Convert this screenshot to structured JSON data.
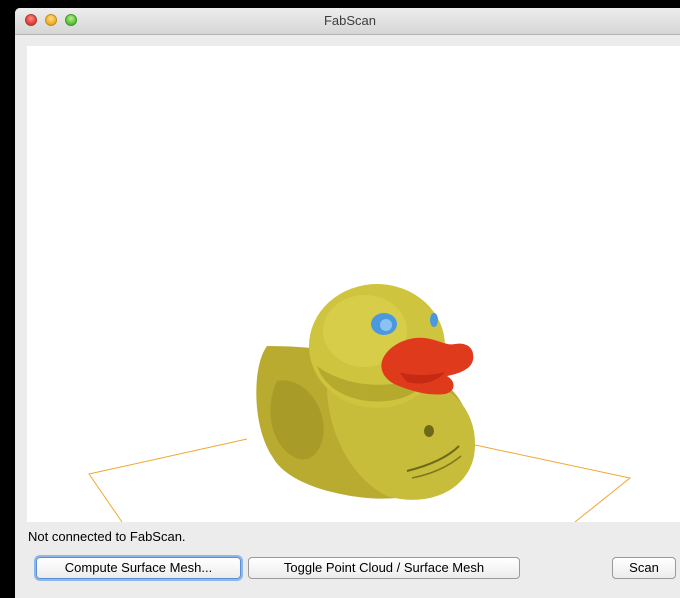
{
  "window": {
    "title": "FabScan"
  },
  "viewport": {
    "description_icon": "point-cloud-duck"
  },
  "status": {
    "text": "Not connected to FabScan."
  },
  "buttons": {
    "compute": "Compute Surface Mesh...",
    "toggle": "Toggle Point Cloud / Surface Mesh",
    "scan": "Scan"
  },
  "colors": {
    "turntable_outline": "#f0a830",
    "duck_body": "#c9be3a",
    "duck_beak": "#e03a1c",
    "duck_eye": "#3a8fd8"
  }
}
